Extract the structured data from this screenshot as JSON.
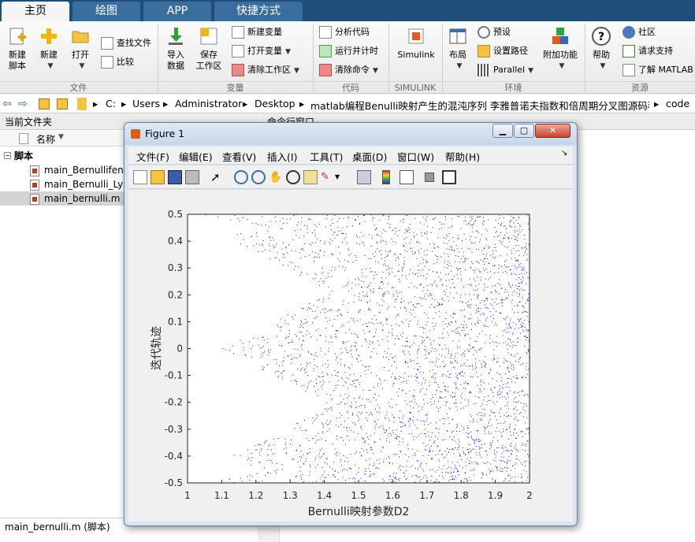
{
  "tabs": [
    "主页",
    "绘图",
    "APP",
    "快捷方式"
  ],
  "ribbon": {
    "file_group": {
      "label": "文件",
      "new_script": "新建\n脚本",
      "new": "新建",
      "open": "打开",
      "find_files": "查找文件",
      "compare": "比较"
    },
    "variable_group": {
      "label": "变量",
      "import": "导入\n数据",
      "save_ws": "保存\n工作区",
      "new_var": "新建变量",
      "open_var": "打开变量",
      "clear_ws": "清除工作区"
    },
    "code_group": {
      "label": "代码",
      "analyze": "分析代码",
      "run_time": "运行并计时",
      "clear_cmd": "清除命令"
    },
    "simulink_group": {
      "label": "SIMULINK",
      "simulink": "Simulink"
    },
    "env_group": {
      "label": "环境",
      "layout": "布局",
      "prefs": "预设",
      "set_path": "设置路径",
      "parallel": "Parallel",
      "addons": "附加功能"
    },
    "resources_group": {
      "label": "资源",
      "help": "帮助",
      "community": "社区",
      "support": "请求支持",
      "learn": "了解 MATLAB"
    }
  },
  "breadcrumbs": [
    "C:",
    "Users",
    "Administrator",
    "Desktop",
    "matlab编程Benulli映射产生的混沌序列 李雅普诺夫指数和倍周期分叉图源码程序",
    "code"
  ],
  "left_panel": {
    "title": "当前文件夹",
    "column_header": "名称",
    "folder": "脚本",
    "files": [
      "main_Bernullifenc",
      "main_Bernulli_Lya",
      "main_bernulli.m"
    ],
    "selected_index": 2,
    "footer": "main_bernulli.m  (脚本)"
  },
  "right_panel": {
    "title": "命令行窗口"
  },
  "figure": {
    "title": "Figure 1",
    "menus": [
      "文件(F)",
      "编辑(E)",
      "查看(V)",
      "插入(I)",
      "工具(T)",
      "桌面(D)",
      "窗口(W)",
      "帮助(H)"
    ],
    "toolbar_icons": [
      "new-figure-icon",
      "open-file-icon",
      "save-icon",
      "print-icon",
      "pointer-icon",
      "zoom-in-icon",
      "zoom-out-icon",
      "pan-icon",
      "rotate-icon",
      "data-cursor-icon",
      "brush-icon",
      "link-icon",
      "colorbar-icon",
      "legend-icon",
      "hide-tools-icon",
      "dock-icon"
    ]
  },
  "chart_data": {
    "type": "scatter",
    "title": "",
    "xlabel": "Bernulli映射参数D2",
    "ylabel": "迭代轨迹",
    "xlim": [
      1,
      2
    ],
    "ylim": [
      -0.5,
      0.5
    ],
    "xticks": [
      "1",
      "1.1",
      "1.2",
      "1.3",
      "1.4",
      "1.5",
      "1.6",
      "1.7",
      "1.8",
      "1.9",
      "2"
    ],
    "yticks": [
      "0.5",
      "0.4",
      "0.3",
      "0.2",
      "0.1",
      "0",
      "-0.1",
      "-0.2",
      "-0.3",
      "-0.4",
      "-0.5"
    ],
    "marker_color": "#0000ff",
    "description_points": "bifurcation diagram of Bernoulli map; chaotic band x in [-0.5,0.5] with white wedges",
    "wedge_regions": [
      {
        "name": "upper",
        "apex_x": 1.42,
        "apex_y": 0.21
      },
      {
        "name": "lower",
        "apex_x": 1.42,
        "apex_y": -0.21
      }
    ]
  }
}
